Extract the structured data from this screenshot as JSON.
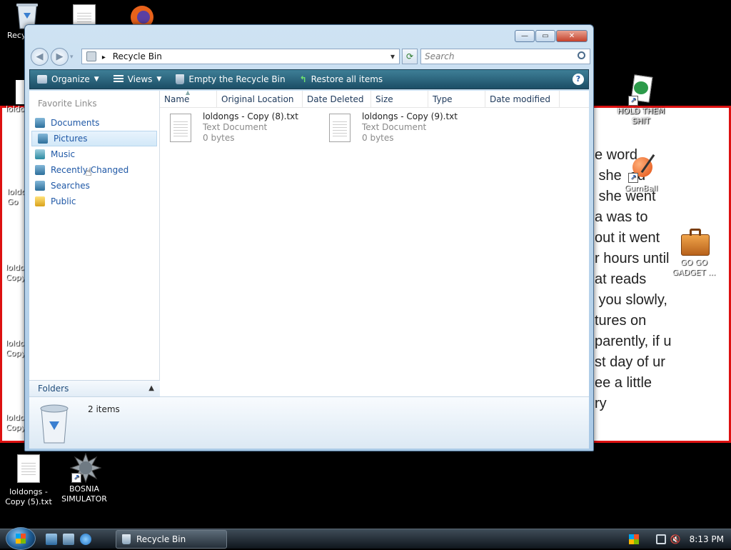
{
  "desktop": {
    "icons": {
      "recycle_bin": "Recy",
      "loldongs_a": "loldo",
      "loldongs_b": "loldo Go",
      "loldongs_c": "loldo Copy",
      "loldongs_d": "loldo Copy",
      "loldongs_e": "loldo Copy",
      "hold_them": "HOLD THEM SHIT",
      "gumball": "GumBall",
      "go_go_gadget": "GO GO GADGET ...",
      "loldongs_5": "loldongs - Copy (5).txt",
      "bosnia": "BOSNIA SIMULATOR"
    },
    "background_text": "e word\n she  ed\n she went\na was to\nout it went\nr hours until\nat reads\n you slowly,\ntures on\nparently, if u\nst day of ur\nee a little\nry"
  },
  "window": {
    "buttons": {
      "minimize": "—",
      "maximize": "▭",
      "close": "✕"
    },
    "address": {
      "crumb_sep": "▸",
      "location": "Recycle Bin",
      "dropdown": "▾",
      "refresh": "⟳"
    },
    "search": {
      "placeholder": "Search",
      "icon": "search-icon"
    },
    "commands": {
      "organize": "Organize",
      "views": "Views",
      "empty": "Empty the Recycle Bin",
      "restore": "Restore all items",
      "help": "?"
    },
    "nav": {
      "header": "Favorite Links",
      "items": [
        "Documents",
        "Pictures",
        "Music",
        "Recently Changed",
        "Searches",
        "Public"
      ],
      "folders": "Folders"
    },
    "columns": [
      "Name",
      "Original Location",
      "Date Deleted",
      "Size",
      "Type",
      "Date modified"
    ],
    "files": [
      {
        "name": "loldongs - Copy (8).txt",
        "type": "Text Document",
        "size": "0 bytes"
      },
      {
        "name": "loldongs - Copy (9).txt",
        "type": "Text Document",
        "size": "0 bytes"
      }
    ],
    "details": {
      "count": "2 items"
    }
  },
  "taskbar": {
    "task": "Recycle Bin",
    "time": "8:13 PM"
  },
  "colors": {
    "window_accent": "#1c4e66",
    "link": "#1f58a6",
    "doc_border": "#d11"
  }
}
